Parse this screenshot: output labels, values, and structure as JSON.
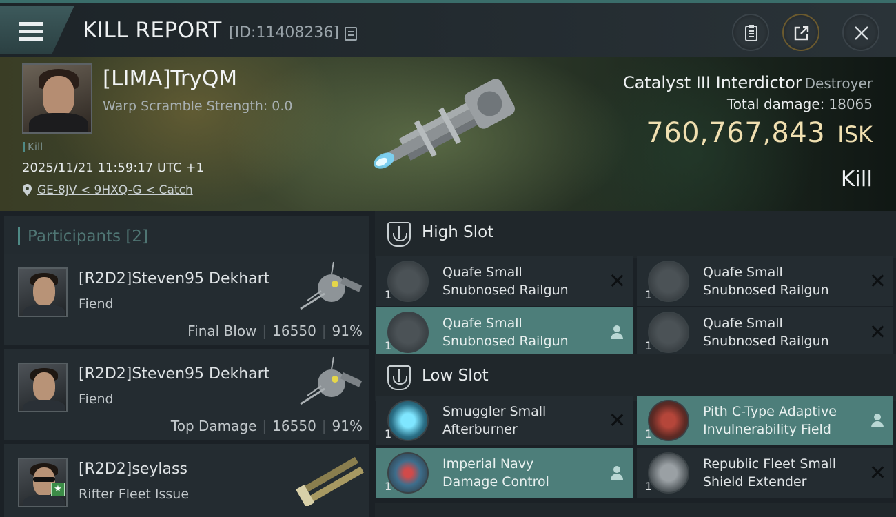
{
  "header": {
    "title": "KILL REPORT",
    "report_id": "[ID:11408236]"
  },
  "victim": {
    "name": "[LIMA]TryQM",
    "warp_scramble": "Warp Scramble Strength: 0.0",
    "tag": "Kill",
    "timestamp": "2025/11/21 11:59:17 UTC +1",
    "location": "GE-8JV < 9HXQ-G < Catch",
    "ship_name": "Catalyst III Interdictor",
    "ship_class": "Destroyer",
    "total_damage_label": "Total damage:",
    "total_damage": "18065",
    "isk_value": "760,767,843",
    "isk_unit": "ISK",
    "result": "Kill"
  },
  "participants": {
    "title": "Participants",
    "count": "[2]",
    "list": [
      {
        "name": "[R2D2]Steven95 Dekhart",
        "ship": "Fiend",
        "role": "Final Blow",
        "damage": "16550",
        "percent": "91%"
      },
      {
        "name": "[R2D2]Steven95 Dekhart",
        "ship": "Fiend",
        "role": "Top Damage",
        "damage": "16550",
        "percent": "91%"
      },
      {
        "name": "[R2D2]seylass",
        "ship": "Rifter Fleet Issue"
      }
    ]
  },
  "slots": {
    "high": {
      "title": "High Slot",
      "modules": [
        {
          "line1": "Quafe Small",
          "line2": "Snubnosed Railgun",
          "qty": "1",
          "status": "destroyed"
        },
        {
          "line1": "Quafe Small",
          "line2": "Snubnosed Railgun",
          "qty": "1",
          "status": "destroyed"
        },
        {
          "line1": "Quafe Small",
          "line2": "Snubnosed Railgun",
          "qty": "1",
          "status": "dropped"
        },
        {
          "line1": "Quafe Small",
          "line2": "Snubnosed Railgun",
          "qty": "1",
          "status": "destroyed"
        }
      ]
    },
    "low": {
      "title": "Low Slot",
      "modules": [
        {
          "line1": "Smuggler Small",
          "line2": "Afterburner",
          "qty": "1",
          "status": "destroyed"
        },
        {
          "line1": "Pith C-Type Adaptive",
          "line2": "Invulnerability Field",
          "qty": "1",
          "status": "dropped"
        },
        {
          "line1": "Imperial Navy",
          "line2": "Damage Control",
          "qty": "1",
          "status": "dropped"
        },
        {
          "line1": "Republic Fleet Small",
          "line2": "Shield Extender",
          "qty": "1",
          "status": "destroyed"
        }
      ]
    }
  },
  "colors": {
    "accent": "#4f8a86",
    "isk": "#f0dfb0",
    "dropped_highlight": "#4d7e7a",
    "panel": "#242c31"
  }
}
